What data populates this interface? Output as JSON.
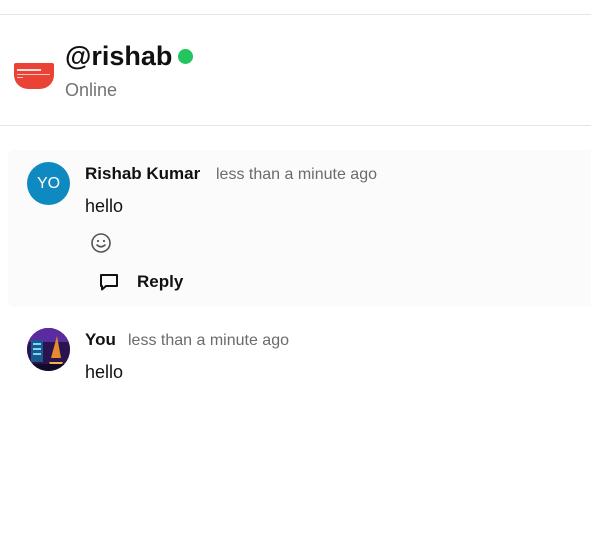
{
  "profile": {
    "username": "@rishab",
    "status": "Online",
    "status_color": "#22c55e",
    "logo_color": "#ea4335"
  },
  "comments": [
    {
      "avatar_initials": "YO",
      "avatar_color": "#0e8ac0",
      "author": "Rishab Kumar",
      "time": "less than a minute ago",
      "body": "hello",
      "reply_label": "Reply",
      "emoji_icon": "smiley-icon",
      "reply_icon": "comment-bubble-icon"
    },
    {
      "avatar": "user-photo",
      "author": "You",
      "time": "less than a minute ago",
      "body": "hello"
    }
  ]
}
